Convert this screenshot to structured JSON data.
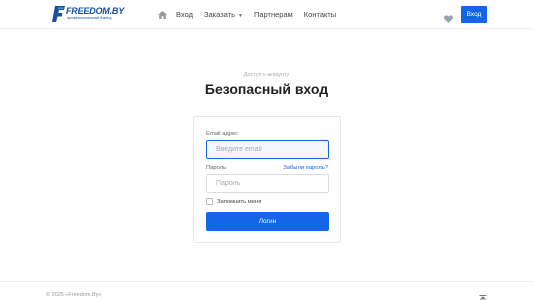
{
  "header": {
    "logo": {
      "name": "FREEDOM.BY",
      "tagline": "профессиональный бэкенд"
    },
    "nav": {
      "home_icon": "home-icon",
      "items": [
        {
          "label": "Вход"
        },
        {
          "label": "Заказать",
          "has_dropdown": true
        },
        {
          "label": "Партнерам"
        },
        {
          "label": "Контакты"
        }
      ]
    },
    "wishlist_icon": "heart-icon",
    "login_button": "Вход"
  },
  "main": {
    "eyebrow": "Доступ к аккаунту",
    "title": "Безопасный вход",
    "form": {
      "email_label": "Email адрес",
      "email_placeholder": "Введите email",
      "password_label": "Пароль",
      "forgot_link": "Забыли пароль?",
      "password_placeholder": "Пароль",
      "remember_label": "Запомнить меня",
      "submit_label": "Логин"
    }
  },
  "footer": {
    "copyright": "© 2025 «Freedom.By»",
    "to_top_icon": "arrow-up-icon"
  },
  "colors": {
    "accent": "#1565e8",
    "brand": "#1a4fa0"
  }
}
